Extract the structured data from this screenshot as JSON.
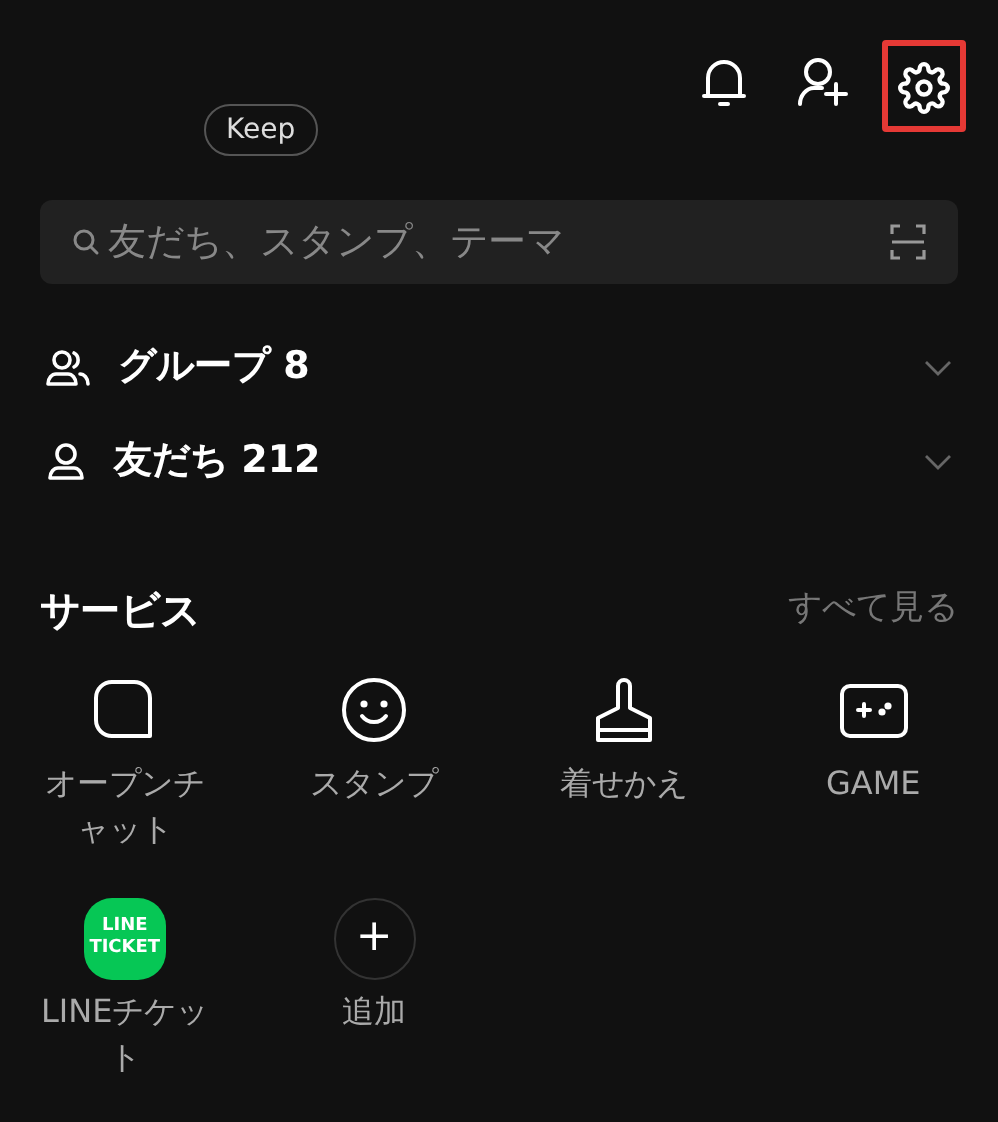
{
  "header": {
    "keep_badge": "Keep",
    "buttons": [
      {
        "kind": "bell",
        "highlighted": false
      },
      {
        "kind": "add-friend",
        "highlighted": false
      },
      {
        "kind": "settings",
        "highlighted": true
      }
    ]
  },
  "search": {
    "placeholder": "友だち、スタンプ、テーマ"
  },
  "lists": [
    {
      "kind": "group",
      "label": "グループ 8"
    },
    {
      "kind": "friend",
      "label": "友だち 212"
    }
  ],
  "services": {
    "title": "サービス",
    "see_all": "すべて見る",
    "items": [
      {
        "kind": "chat",
        "label": "オープンチャット"
      },
      {
        "kind": "smile",
        "label": "スタンプ"
      },
      {
        "kind": "brush",
        "label": "着せかえ"
      },
      {
        "kind": "game",
        "label": "GAME"
      },
      {
        "kind": "ticket",
        "label": "LINEチケット",
        "logo": [
          "LINE",
          "TICKET"
        ]
      },
      {
        "kind": "add",
        "label": "追加",
        "symbol": "+"
      }
    ]
  }
}
